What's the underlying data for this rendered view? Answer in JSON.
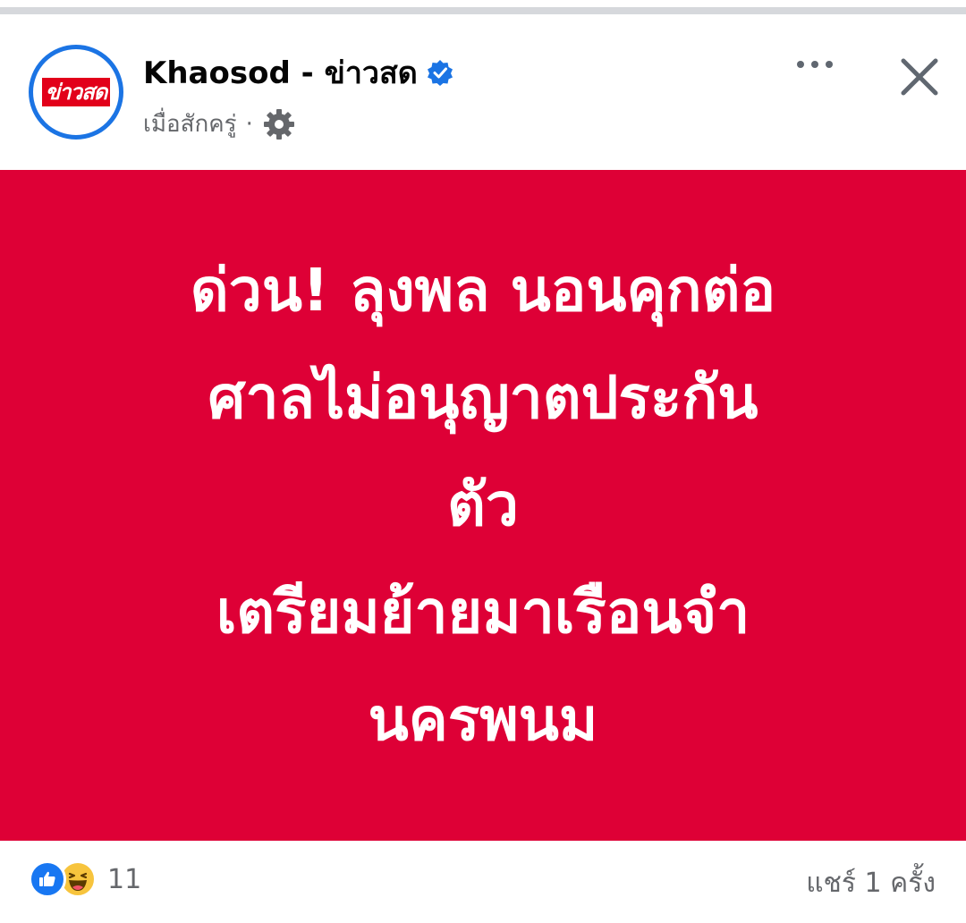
{
  "post": {
    "page_name": "Khaosod - ข่าวสด",
    "logo_text": "ข่าวสด",
    "timestamp": "เมื่อสักครู่",
    "separator": "·",
    "verified": true
  },
  "headline": {
    "line1": "ด่วน! ลุงพล นอนคุกต่อ",
    "line2": "ศาลไม่อนุญาตประกัน",
    "line3": "ตัว",
    "line4": "เตรียมย้ายมาเรือนจำ",
    "line5": "นครพนม"
  },
  "footer": {
    "reaction_count": "11",
    "shares": "แชร์ 1 ครั้ง"
  },
  "colors": {
    "banner": "#de0036",
    "verified": "#1b74e4",
    "like": "#1877f2",
    "haha": "#f7c43d"
  },
  "icons": [
    "verified-badge-icon",
    "privacy-gear-icon",
    "more-options-icon",
    "close-icon",
    "like-reaction-icon",
    "haha-reaction-icon"
  ]
}
